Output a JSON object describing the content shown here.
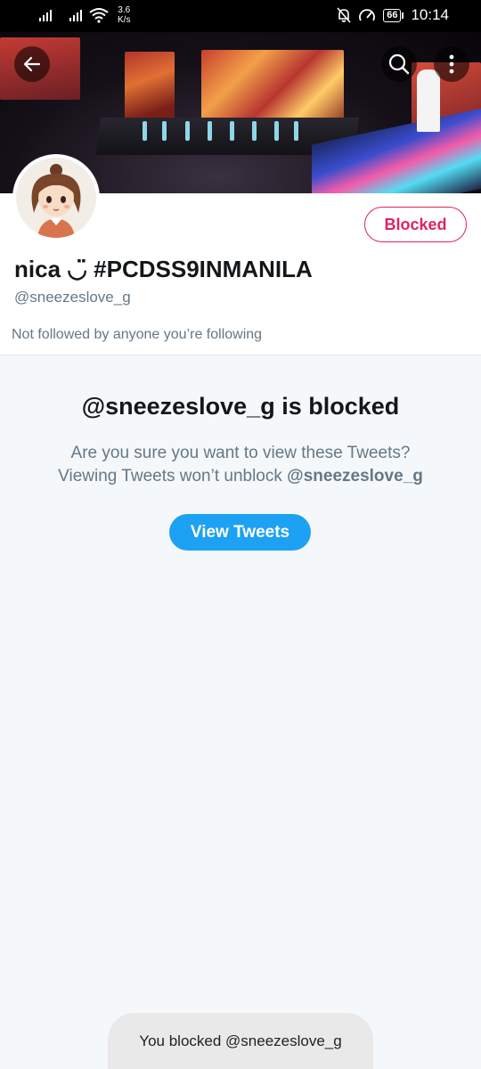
{
  "status_bar": {
    "net_speed_value": "3.6",
    "net_speed_unit": "K/s",
    "battery": "66",
    "time": "10:14"
  },
  "header": {
    "back_icon": "arrow-left-icon",
    "search_icon": "search-icon",
    "more_icon": "more-vertical-icon"
  },
  "profile": {
    "blocked_label": "Blocked",
    "display_name": "nica ◡̈ #PCDSS9INMANILA",
    "handle": "@sneezeslove_g",
    "not_followed_text": "Not followed by anyone you’re following"
  },
  "blocked_notice": {
    "title": "@sneezeslove_g is blocked",
    "line1": "Are you sure you want to view these Tweets?",
    "line2_prefix": "Viewing Tweets won’t unblock ",
    "line2_handle": "@sneezeslove_g",
    "view_button": "View Tweets"
  },
  "toast": {
    "message": "You blocked @sneezeslove_g"
  },
  "colors": {
    "accent_blue": "#1da1f2",
    "blocked_red": "#e0245e",
    "secondary_text": "#657786"
  }
}
